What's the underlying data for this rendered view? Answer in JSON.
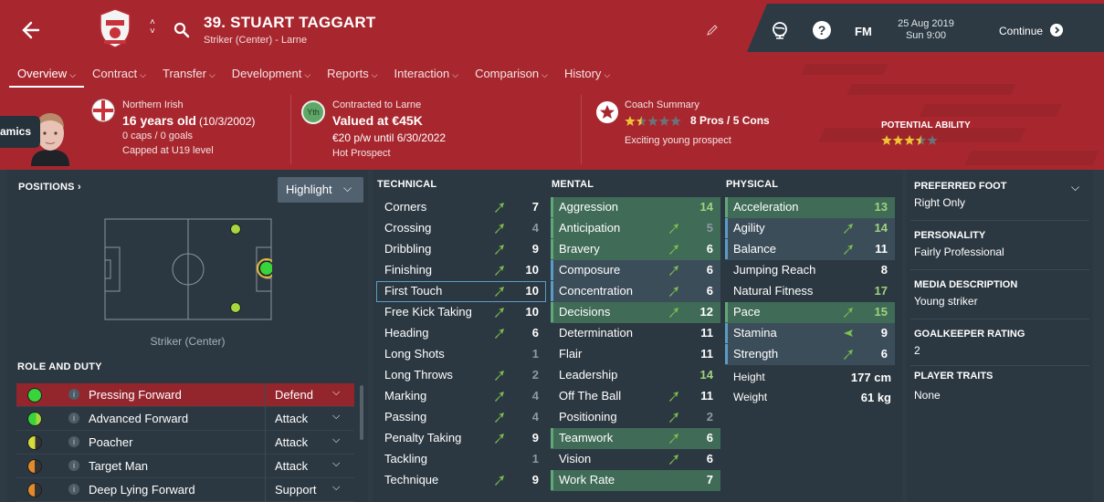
{
  "header": {
    "player_title": "39. STUART TAGGART",
    "subtitle": "Striker (Center) - Larne",
    "colors": {
      "header_bg": "#a8272f",
      "panel_bg": "#2c3841",
      "key_attr_bg": "#3f6b57",
      "hl_attr_bg": "#3c4d5a",
      "accent_green": "#9ed47c"
    }
  },
  "topbar": {
    "fm_label": "FM",
    "date": "25 Aug 2019",
    "time": "Sun 9:00",
    "continue_label": "Continue",
    "icons": [
      "globe-icon",
      "help-icon",
      "chevron-right-icon"
    ]
  },
  "tabs": [
    {
      "label": "Overview"
    },
    {
      "label": "Contract"
    },
    {
      "label": "Transfer"
    },
    {
      "label": "Development"
    },
    {
      "label": "Reports"
    },
    {
      "label": "Interaction"
    },
    {
      "label": "Comparison"
    },
    {
      "label": "History"
    }
  ],
  "info": {
    "nationality": "Northern Irish",
    "age": "16 years old",
    "dob": "(10/3/2002)",
    "caps": "0 caps / 0 goals",
    "capped": "Capped at U19 level",
    "youth_badge": "Yth",
    "contracted": "Contracted to Larne",
    "value": "Valued at €45K",
    "wage": "€20 p/w until 6/30/2022",
    "prospect": "Hot Prospect",
    "coach_summary_label": "Coach Summary",
    "pros_cons": "8 Pros / 5 Cons",
    "coach_stars": 1.5,
    "coach_note": "Exciting young prospect",
    "potential_label": "POTENTIAL ABILITY",
    "potential_stars": 3.5,
    "side_tab": "amics"
  },
  "positions": {
    "heading": "POSITIONS",
    "heading_arrow": "›",
    "highlight_label": "Highlight",
    "caption": "Striker (Center)"
  },
  "roles": {
    "heading": "ROLE AND DUTY",
    "info_glyph": "i",
    "rows": [
      {
        "name": "Pressing Forward",
        "duty": "Defend",
        "suit": "full-green",
        "selected": true
      },
      {
        "name": "Advanced Forward",
        "duty": "Attack",
        "suit": "green"
      },
      {
        "name": "Poacher",
        "duty": "Attack",
        "suit": "yellow"
      },
      {
        "name": "Target Man",
        "duty": "Attack",
        "suit": "orange"
      },
      {
        "name": "Deep Lying Forward",
        "duty": "Support",
        "suit": "orange"
      }
    ]
  },
  "attributes": {
    "technical_heading": "TECHNICAL",
    "mental_heading": "MENTAL",
    "physical_heading": "PHYSICAL",
    "technical": [
      {
        "name": "Corners",
        "value": "7",
        "trend": "up"
      },
      {
        "name": "Crossing",
        "value": "4",
        "trend": "up"
      },
      {
        "name": "Dribbling",
        "value": "9",
        "trend": "up"
      },
      {
        "name": "Finishing",
        "value": "10",
        "trend": "up"
      },
      {
        "name": "First Touch",
        "value": "10",
        "trend": "up",
        "style": "boxed"
      },
      {
        "name": "Free Kick Taking",
        "value": "10",
        "trend": "up"
      },
      {
        "name": "Heading",
        "value": "6",
        "trend": "up"
      },
      {
        "name": "Long Shots",
        "value": "1"
      },
      {
        "name": "Long Throws",
        "value": "2",
        "trend": "up"
      },
      {
        "name": "Marking",
        "value": "4",
        "trend": "up"
      },
      {
        "name": "Passing",
        "value": "4",
        "trend": "up"
      },
      {
        "name": "Penalty Taking",
        "value": "9",
        "trend": "up"
      },
      {
        "name": "Tackling",
        "value": "1"
      },
      {
        "name": "Technique",
        "value": "9",
        "trend": "up"
      }
    ],
    "mental": [
      {
        "name": "Aggression",
        "value": "14",
        "style": "key"
      },
      {
        "name": "Anticipation",
        "value": "5",
        "trend": "up",
        "style": "key"
      },
      {
        "name": "Bravery",
        "value": "6",
        "trend": "up",
        "style": "key"
      },
      {
        "name": "Composure",
        "value": "6",
        "trend": "up",
        "style": "bl"
      },
      {
        "name": "Concentration",
        "value": "6",
        "trend": "up",
        "style": "bl"
      },
      {
        "name": "Decisions",
        "value": "12",
        "trend": "up",
        "style": "key"
      },
      {
        "name": "Determination",
        "value": "11"
      },
      {
        "name": "Flair",
        "value": "11"
      },
      {
        "name": "Leadership",
        "value": "14"
      },
      {
        "name": "Off The Ball",
        "value": "11",
        "trend": "up"
      },
      {
        "name": "Positioning",
        "value": "2",
        "trend": "up"
      },
      {
        "name": "Teamwork",
        "value": "6",
        "trend": "up",
        "style": "key"
      },
      {
        "name": "Vision",
        "value": "6",
        "trend": "up"
      },
      {
        "name": "Work Rate",
        "value": "7",
        "style": "key"
      }
    ],
    "physical": [
      {
        "name": "Acceleration",
        "value": "13",
        "style": "key"
      },
      {
        "name": "Agility",
        "value": "14",
        "trend": "up",
        "style": "bl"
      },
      {
        "name": "Balance",
        "value": "11",
        "trend": "up",
        "style": "bl"
      },
      {
        "name": "Jumping Reach",
        "value": "8"
      },
      {
        "name": "Natural Fitness",
        "value": "17"
      },
      {
        "name": "Pace",
        "value": "15",
        "trend": "up",
        "style": "key"
      },
      {
        "name": "Stamina",
        "value": "9",
        "trend": "flat",
        "style": "bl"
      },
      {
        "name": "Strength",
        "value": "6",
        "trend": "up",
        "style": "bl"
      }
    ],
    "height_label": "Height",
    "height": "177 cm",
    "weight_label": "Weight",
    "weight": "61 kg"
  },
  "profile": {
    "preferred_foot_heading": "PREFERRED FOOT",
    "preferred_foot": "Right Only",
    "personality_heading": "PERSONALITY",
    "personality": "Fairly Professional",
    "media_heading": "MEDIA DESCRIPTION",
    "media": "Young striker",
    "gk_heading": "GOALKEEPER RATING",
    "gk": "2",
    "traits_heading": "PLAYER TRAITS",
    "traits": "None"
  }
}
